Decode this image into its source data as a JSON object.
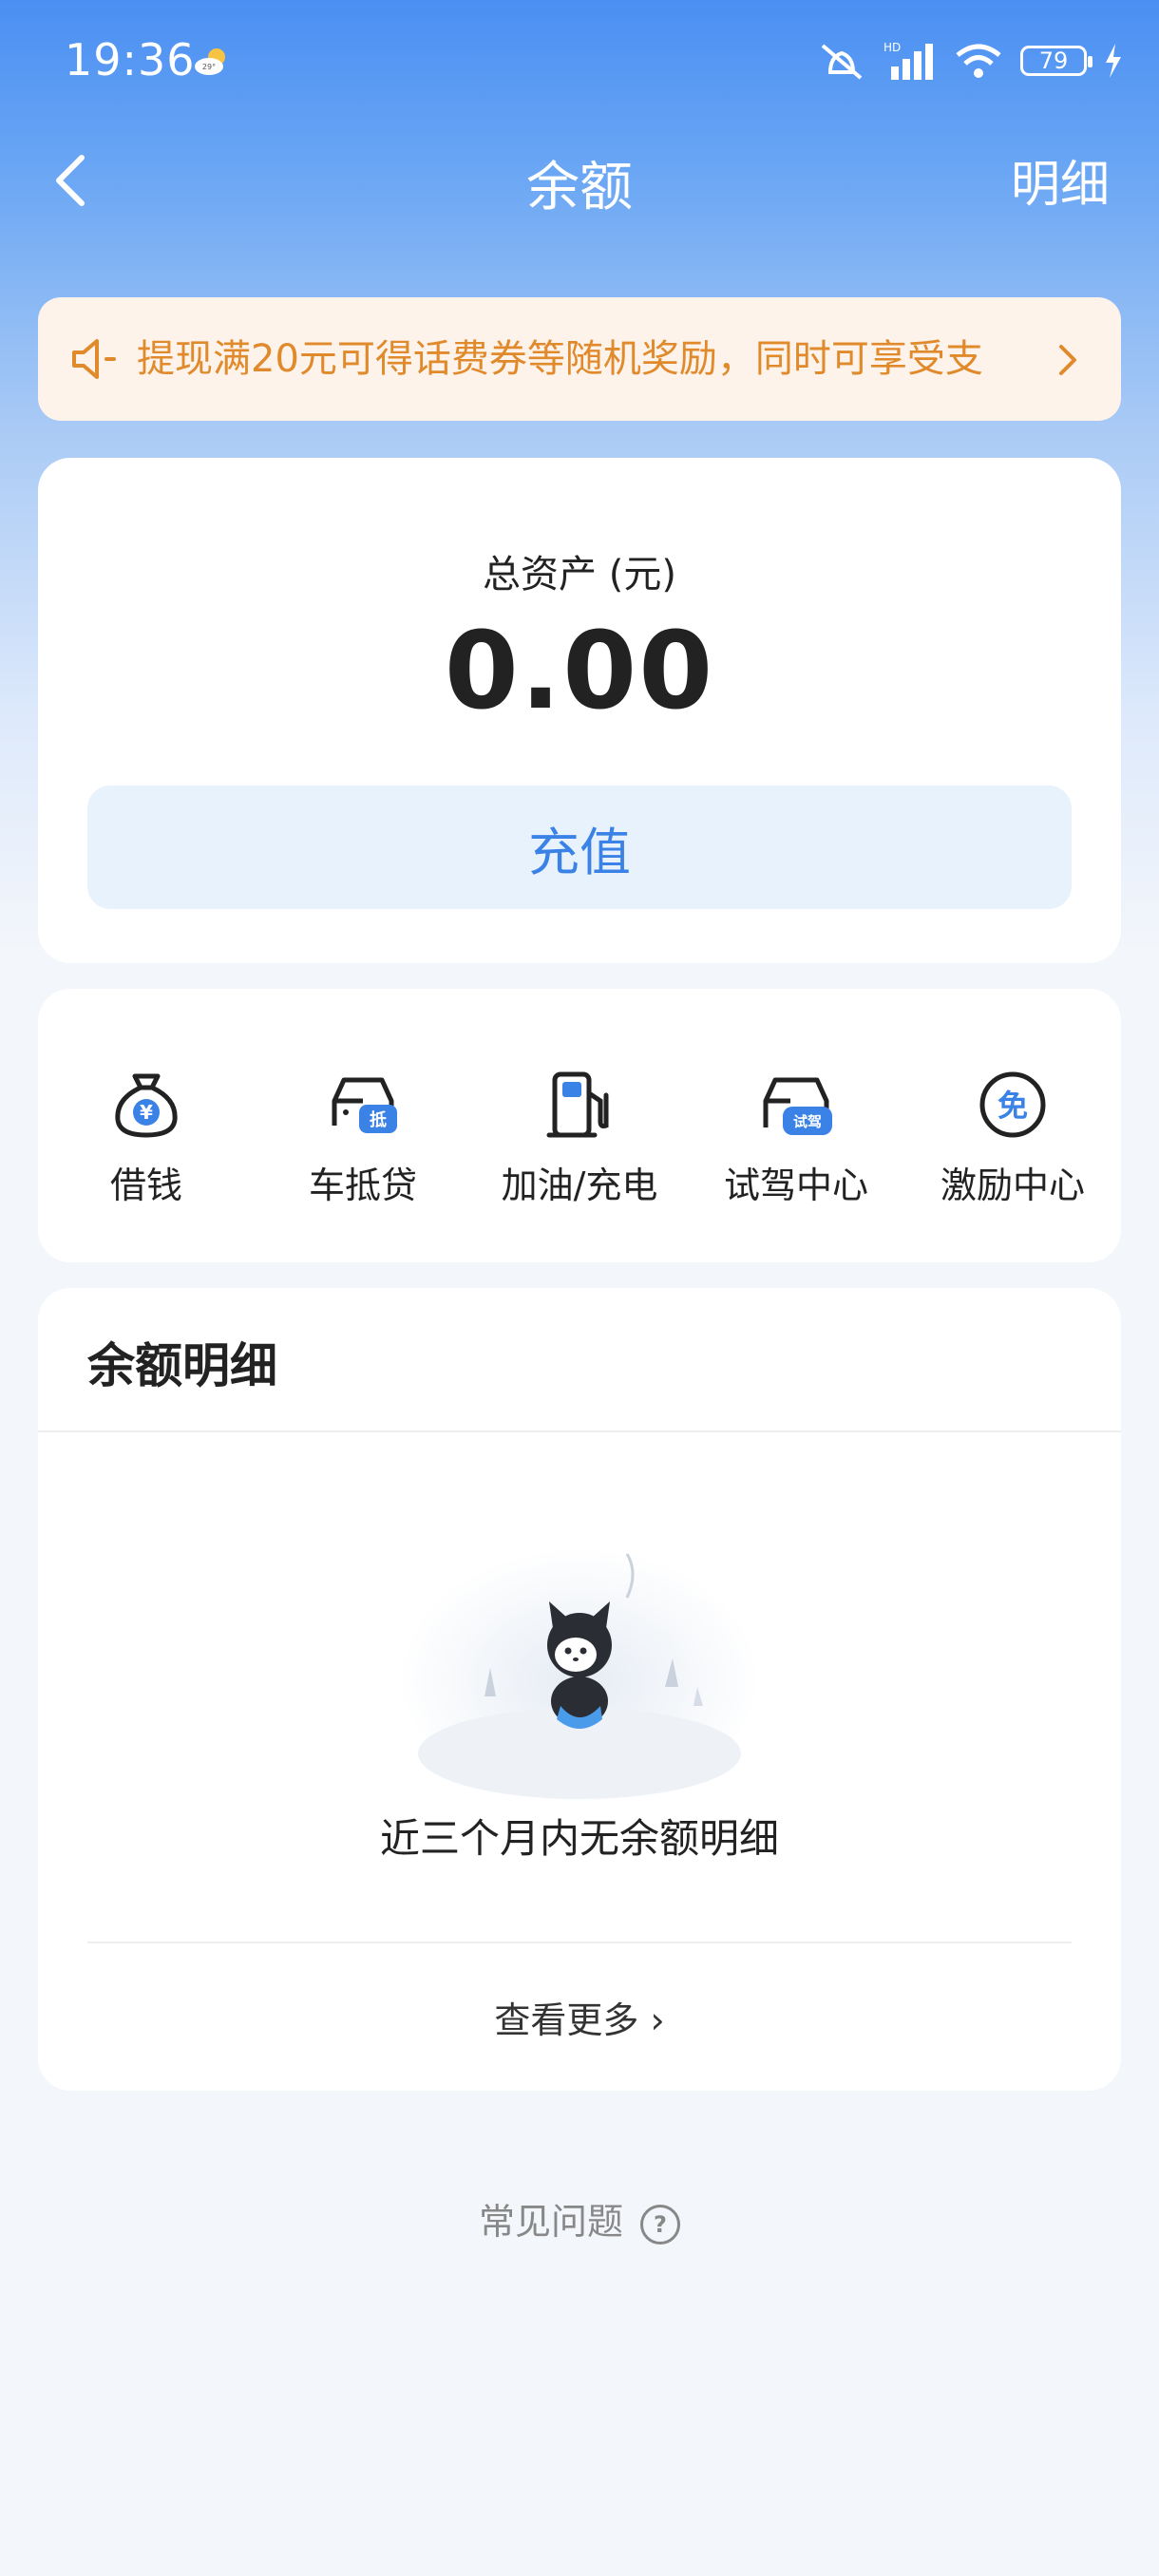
{
  "status_bar": {
    "time": "19:36",
    "weather_temp": "29°",
    "network": "HD",
    "battery": "79"
  },
  "nav": {
    "title": "余额",
    "detail_link": "明细"
  },
  "notice": {
    "text": "提现满20元可得话费券等随机奖励，同时可享受支"
  },
  "balance": {
    "label": "总资产 (元)",
    "value": "0.00",
    "recharge_label": "充值"
  },
  "services": [
    {
      "label": "借钱",
      "icon": "money-bag-icon"
    },
    {
      "label": "车抵贷",
      "icon": "car-loan-icon",
      "badge": "抵"
    },
    {
      "label": "加油/充电",
      "icon": "fuel-pump-icon"
    },
    {
      "label": "试驾中心",
      "icon": "test-drive-icon",
      "badge": "试驾"
    },
    {
      "label": "激励中心",
      "icon": "incentive-icon",
      "badge": "免"
    }
  ],
  "detail": {
    "title": "余额明细",
    "empty_text": "近三个月内无余额明细",
    "more_label": "查看更多 ›"
  },
  "faq": {
    "label": "常见问题"
  },
  "colors": {
    "accent": "#3b82e6",
    "notice_text": "#e08a2c",
    "notice_bg": "#fdf3ea"
  }
}
